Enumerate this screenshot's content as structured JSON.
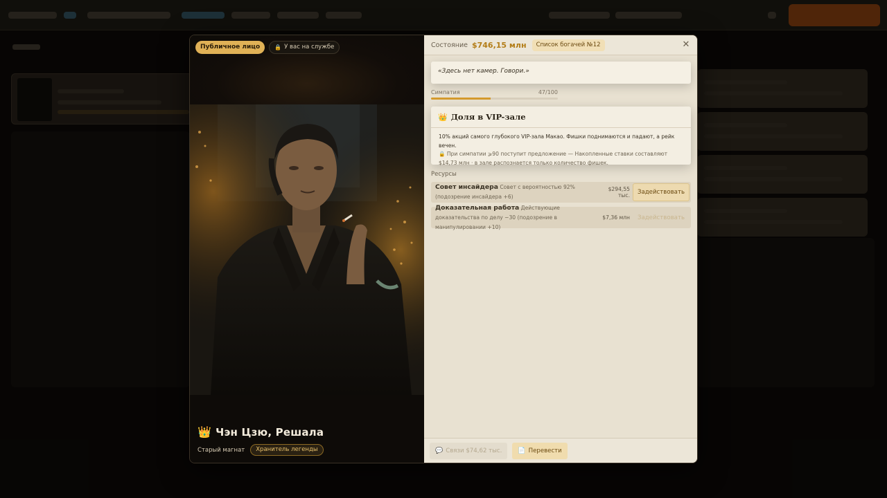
{
  "modal": {
    "badges": {
      "public_face": "Публичное лицо",
      "in_service": "У вас на службе"
    },
    "character": {
      "name": "Чэн Цзю, Решала",
      "role": "Старый магнат",
      "tag": "Хранитель легенды"
    },
    "header": {
      "state_label": "Состояние",
      "state_value": "$746,15 млн",
      "rich_list": "Список богачей №12"
    },
    "quote": "«Здесь нет камер. Говори.»",
    "sympathy": {
      "label": "Симпатия",
      "value_text": "47/100",
      "fraction": 0.47
    },
    "vip": {
      "title": "Доля в VIP-зале",
      "description": "10% акций самого глубокого VIP-зала Макао. Фишки поднимаются и падают, а рейк вечен.",
      "note": "При симпатии ⩾90 поступит предложение — Накопленные ставки составляют $14,73 млн · в зале распознается только количество фишек."
    },
    "resources": {
      "label": "Ресурсы",
      "items": [
        {
          "name": "Совет инсайдера",
          "description": "Совет с вероятностью 92% (подозрение инсайдера +6)",
          "price": "$294,55 тыс.",
          "action": "Задействовать"
        },
        {
          "name": "Доказательная работа",
          "description": "Действующие доказательства по делу −30 (подозрение в манипулировании +10)",
          "price": "$7,36 млн",
          "action": "Задействовать"
        }
      ]
    },
    "footer": {
      "links": "Связи $74,62 тыс.",
      "translate": "Перевести"
    }
  },
  "icons": {
    "crown": "crown-icon",
    "lock": "lock-icon",
    "close": "close-icon",
    "chat": "chat-icon",
    "document": "document-icon"
  },
  "colors": {
    "gold_accent": "#e0b156",
    "value_text": "#b37d18",
    "panel_bg": "#e8e1d1",
    "sympathy_fill": "#d59a2c"
  }
}
